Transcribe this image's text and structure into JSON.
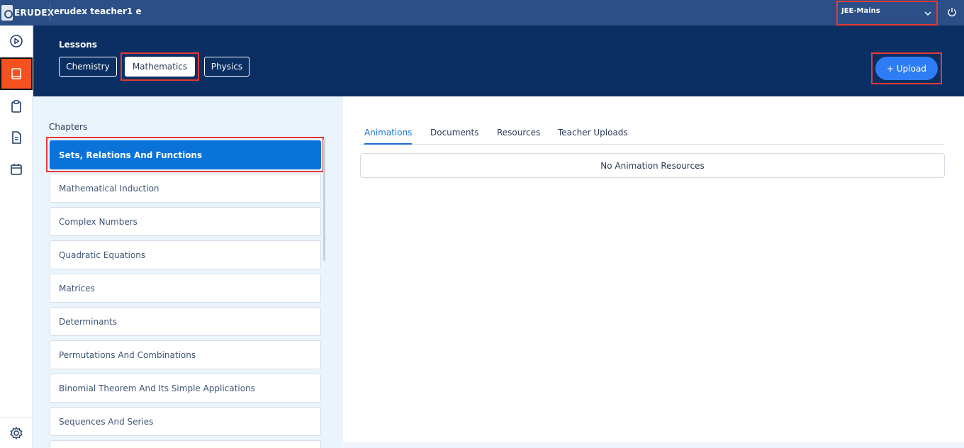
{
  "topbar": {
    "logo_text": "ERUDEX",
    "user_name": "erudex teacher1 e",
    "exam_selected": "JEE-Mains"
  },
  "rail": {
    "items": [
      {
        "icon": "play-circle-icon"
      },
      {
        "icon": "book-icon"
      },
      {
        "icon": "clipboard-icon"
      },
      {
        "icon": "document-icon"
      },
      {
        "icon": "calendar-icon"
      }
    ],
    "bottom_icon": "gear-icon"
  },
  "header": {
    "lessons_label": "Lessons",
    "subjects": [
      "Chemistry",
      "Mathematics",
      "Physics"
    ],
    "active_subject": "Mathematics",
    "upload_label": "+ Upload"
  },
  "chapters": {
    "title": "Chapters",
    "items": [
      "Sets, Relations And Functions",
      "Mathematical Induction",
      "Complex Numbers",
      "Quadratic Equations",
      "Matrices",
      "Determinants",
      "Permutations And Combinations",
      "Binomial Theorem And Its Simple Applications",
      "Sequences And Series"
    ],
    "active_index": 0
  },
  "content": {
    "tabs": [
      "Animations",
      "Documents",
      "Resources",
      "Teacher Uploads"
    ],
    "active_tab": "Animations",
    "empty_message": "No Animation Resources"
  },
  "colors": {
    "topbar": "#2b4f86",
    "header": "#0b2f63",
    "accent": "#0a73d9",
    "rail_active": "#f4511e",
    "upload": "#2f7df4",
    "highlight": "#e53935"
  }
}
